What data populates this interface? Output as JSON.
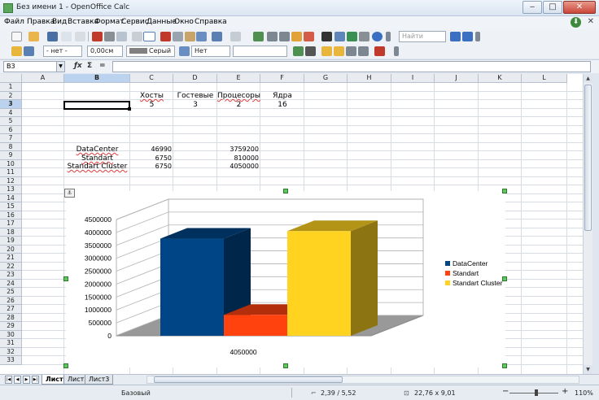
{
  "window": {
    "title": "Без имени 1 - OpenOffice Calc",
    "buttons": [
      "‒",
      "□",
      "✕"
    ]
  },
  "menu": [
    "Файл",
    "Правка",
    "Вид",
    "Вставка",
    "Формат",
    "Сервис",
    "Данные",
    "Окно",
    "Справка"
  ],
  "toolbar": {
    "search_placeholder": "Найти",
    "border_style": "- нет -",
    "line_width": "0,00см",
    "line_color": "Серый",
    "area_style": "Нет"
  },
  "formula_bar": {
    "cell_ref": "B3",
    "formula": ""
  },
  "columns": [
    "A",
    "B",
    "C",
    "D",
    "E",
    "F",
    "G",
    "H",
    "I",
    "J",
    "K",
    "L"
  ],
  "selected_column": "B",
  "rows": [
    "1",
    "2",
    "3",
    "4",
    "5",
    "6",
    "7",
    "8",
    "9",
    "10",
    "11",
    "12",
    "13",
    "14",
    "15",
    "16",
    "17",
    "18",
    "19",
    "20",
    "21",
    "22",
    "23",
    "24",
    "25",
    "26",
    "27",
    "28",
    "29",
    "30",
    "31",
    "32",
    "33"
  ],
  "selected_row": "3",
  "cells": {
    "C2": "Хосты",
    "D2": "Гостевые",
    "E2": "Процесоры",
    "F2": "Ядра",
    "C3": "5",
    "D3": "3",
    "E3": "2",
    "F3": "16",
    "B8": "DataCenter",
    "C8": "46990",
    "E8": "3759200",
    "B9": "Standart",
    "C9": "6750",
    "E9": "810000",
    "B10": "Standart Cluster",
    "C10": "6750",
    "E10": "4050000"
  },
  "chart_data": {
    "type": "bar",
    "categories": [
      "4050000"
    ],
    "series": [
      {
        "name": "DataCenter",
        "values": [
          3759200
        ],
        "color": "#004586"
      },
      {
        "name": "Standart",
        "values": [
          810000
        ],
        "color": "#ff420e"
      },
      {
        "name": "Standart Cluster",
        "values": [
          4050000
        ],
        "color": "#ffd320"
      }
    ],
    "y_ticks": [
      "0",
      "500000",
      "1000000",
      "1500000",
      "2000000",
      "2500000",
      "3000000",
      "3500000",
      "4000000",
      "4500000"
    ],
    "ylim": [
      0,
      4500000
    ],
    "grid": true,
    "legend": "right",
    "style": "3d"
  },
  "sheets": [
    "Лист1",
    "Лист2",
    "Лист3"
  ],
  "active_sheet": "Лист1",
  "status": {
    "style": "Базовый",
    "position": "2,39 / 5,52",
    "size": "22,76 x 9,01",
    "zoom": "110%"
  }
}
